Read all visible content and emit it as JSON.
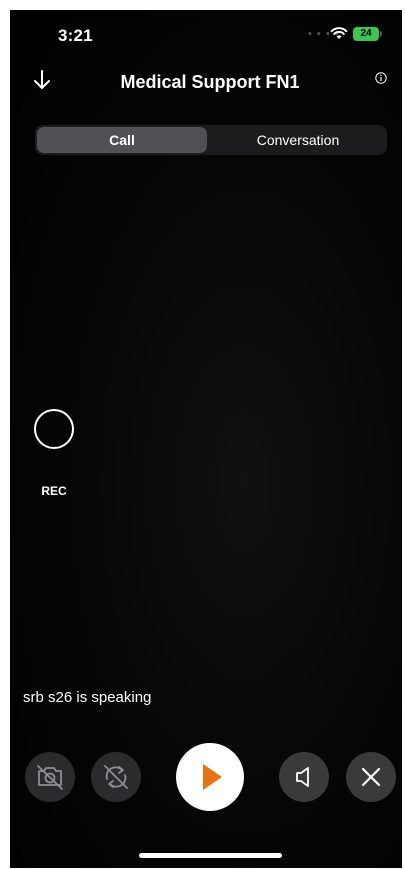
{
  "status_bar": {
    "time": "3:21",
    "battery": "24",
    "signal_icon": "signal-dots-icon",
    "wifi_icon": "wifi-icon",
    "battery_color": "#39c752"
  },
  "header": {
    "title": "Medical Support FN1",
    "back_icon": "arrow-down-icon",
    "info_icon": "info-icon"
  },
  "tabs": [
    {
      "label": "Call",
      "selected": true
    },
    {
      "label": "Conversation",
      "selected": false
    }
  ],
  "recording": {
    "label": "REC",
    "icon": "record-circle-icon"
  },
  "speaking_status": "srb s26 is speaking",
  "controls": [
    {
      "name": "camera-off",
      "icon": "camera-off-icon"
    },
    {
      "name": "switch-camera",
      "icon": "switch-camera-icon"
    },
    {
      "name": "play",
      "icon": "play-icon",
      "accent": "#e8730f"
    },
    {
      "name": "speaker",
      "icon": "speaker-icon"
    },
    {
      "name": "end-call",
      "icon": "close-icon"
    }
  ]
}
